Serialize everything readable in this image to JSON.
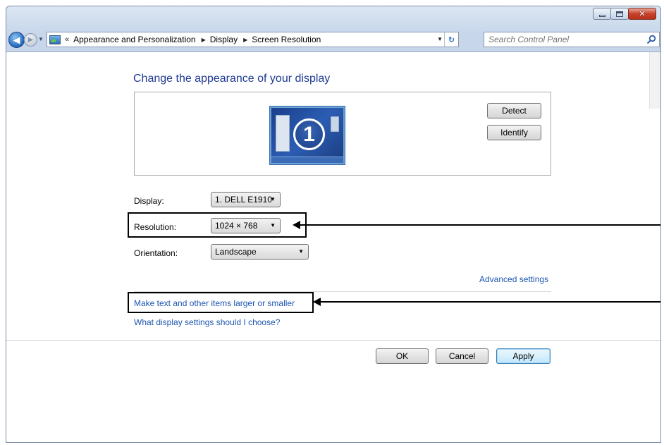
{
  "window": {
    "caption": {
      "minimize_icon": "minimize-icon",
      "maximize_icon": "maximize-icon",
      "close_glyph": "✕"
    }
  },
  "navbar": {
    "back_glyph": "◀",
    "forward_glyph": "▶",
    "history_glyph": "▼",
    "breadcrumb_overflow": "«",
    "breadcrumbs": [
      "Appearance and Personalization",
      "Display",
      "Screen Resolution"
    ],
    "separator_glyph": "▶",
    "address_dropdown_glyph": "▼",
    "refresh_glyph": "↻",
    "search_placeholder": "Search Control Panel"
  },
  "main": {
    "title": "Change the appearance of your display",
    "monitor_number": "1",
    "detect_label": "Detect",
    "identify_label": "Identify",
    "display_label": "Display:",
    "display_value": "1. DELL E1910",
    "resolution_label": "Resolution:",
    "resolution_value": "1024 × 768",
    "orientation_label": "Orientation:",
    "orientation_value": "Landscape",
    "combo_arrow": "▼",
    "advanced_link": "Advanced settings",
    "text_size_link": "Make text and other items larger or smaller",
    "help_link": "What display settings should I choose?"
  },
  "footer": {
    "ok_label": "OK",
    "cancel_label": "Cancel",
    "apply_label": "Apply"
  },
  "colors": {
    "link": "#1c55b0",
    "title": "#1f3a93",
    "annotation": "#000000"
  }
}
